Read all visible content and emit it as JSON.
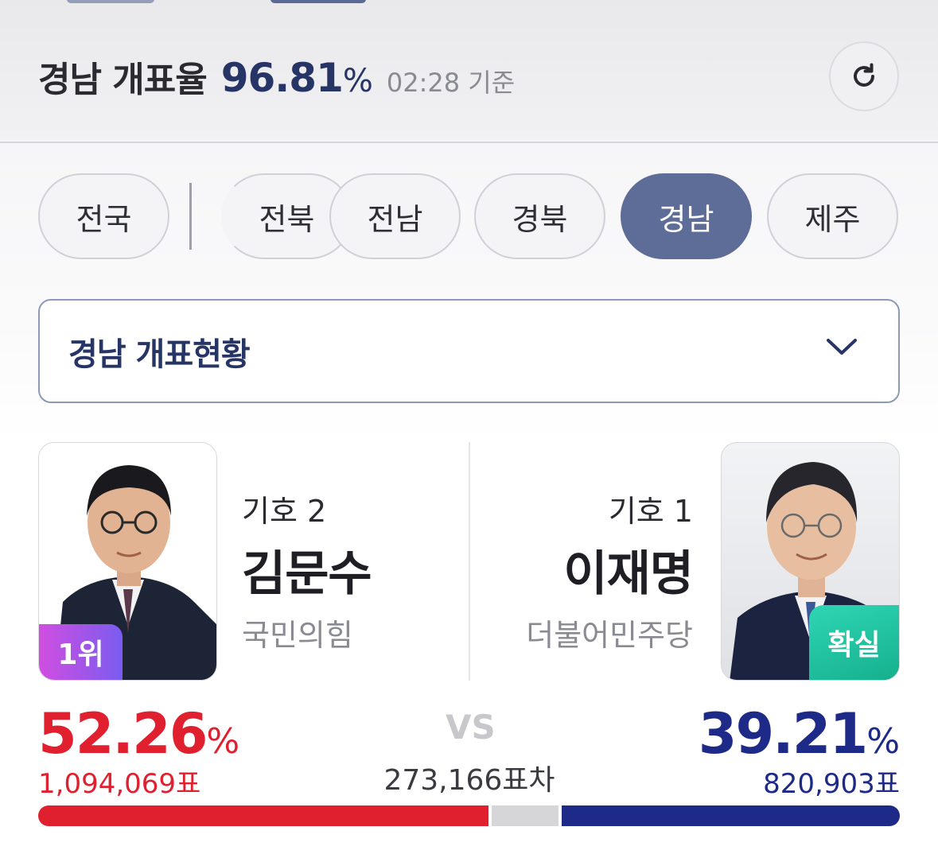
{
  "header": {
    "title": "경남 개표율",
    "rate": "96.81",
    "rate_unit": "%",
    "time": "02:28 기준"
  },
  "tabs": [
    {
      "label": "전국",
      "active": false
    },
    {
      "label": "전북",
      "active": false
    },
    {
      "label": "전남",
      "active": false
    },
    {
      "label": "경북",
      "active": false
    },
    {
      "label": "경남",
      "active": true
    },
    {
      "label": "제주",
      "active": false
    }
  ],
  "dropdown": {
    "label": "경남 개표현황"
  },
  "candidates": {
    "left": {
      "number": "기호 2",
      "name": "김문수",
      "party": "국민의힘",
      "badge": "1위",
      "percent": "52.26",
      "percent_unit": "%",
      "votes": "1,094,069표",
      "share": 0.5226
    },
    "right": {
      "number": "기호 1",
      "name": "이재명",
      "party": "더불어민주당",
      "badge": "확실",
      "percent": "39.21",
      "percent_unit": "%",
      "votes": "820,903표",
      "share": 0.3921
    }
  },
  "comparison": {
    "vs": "VS",
    "difference": "273,166표차"
  },
  "colors": {
    "accent": "#263566",
    "left_party": "#e0202f",
    "right_party": "#1e2a88",
    "active_tab": "#5e6d97",
    "rank_badge": "#b153e6",
    "sure_badge": "#1fc3a0"
  },
  "icons": {
    "refresh": "refresh-icon",
    "dropdown": "chevron-down-icon"
  }
}
